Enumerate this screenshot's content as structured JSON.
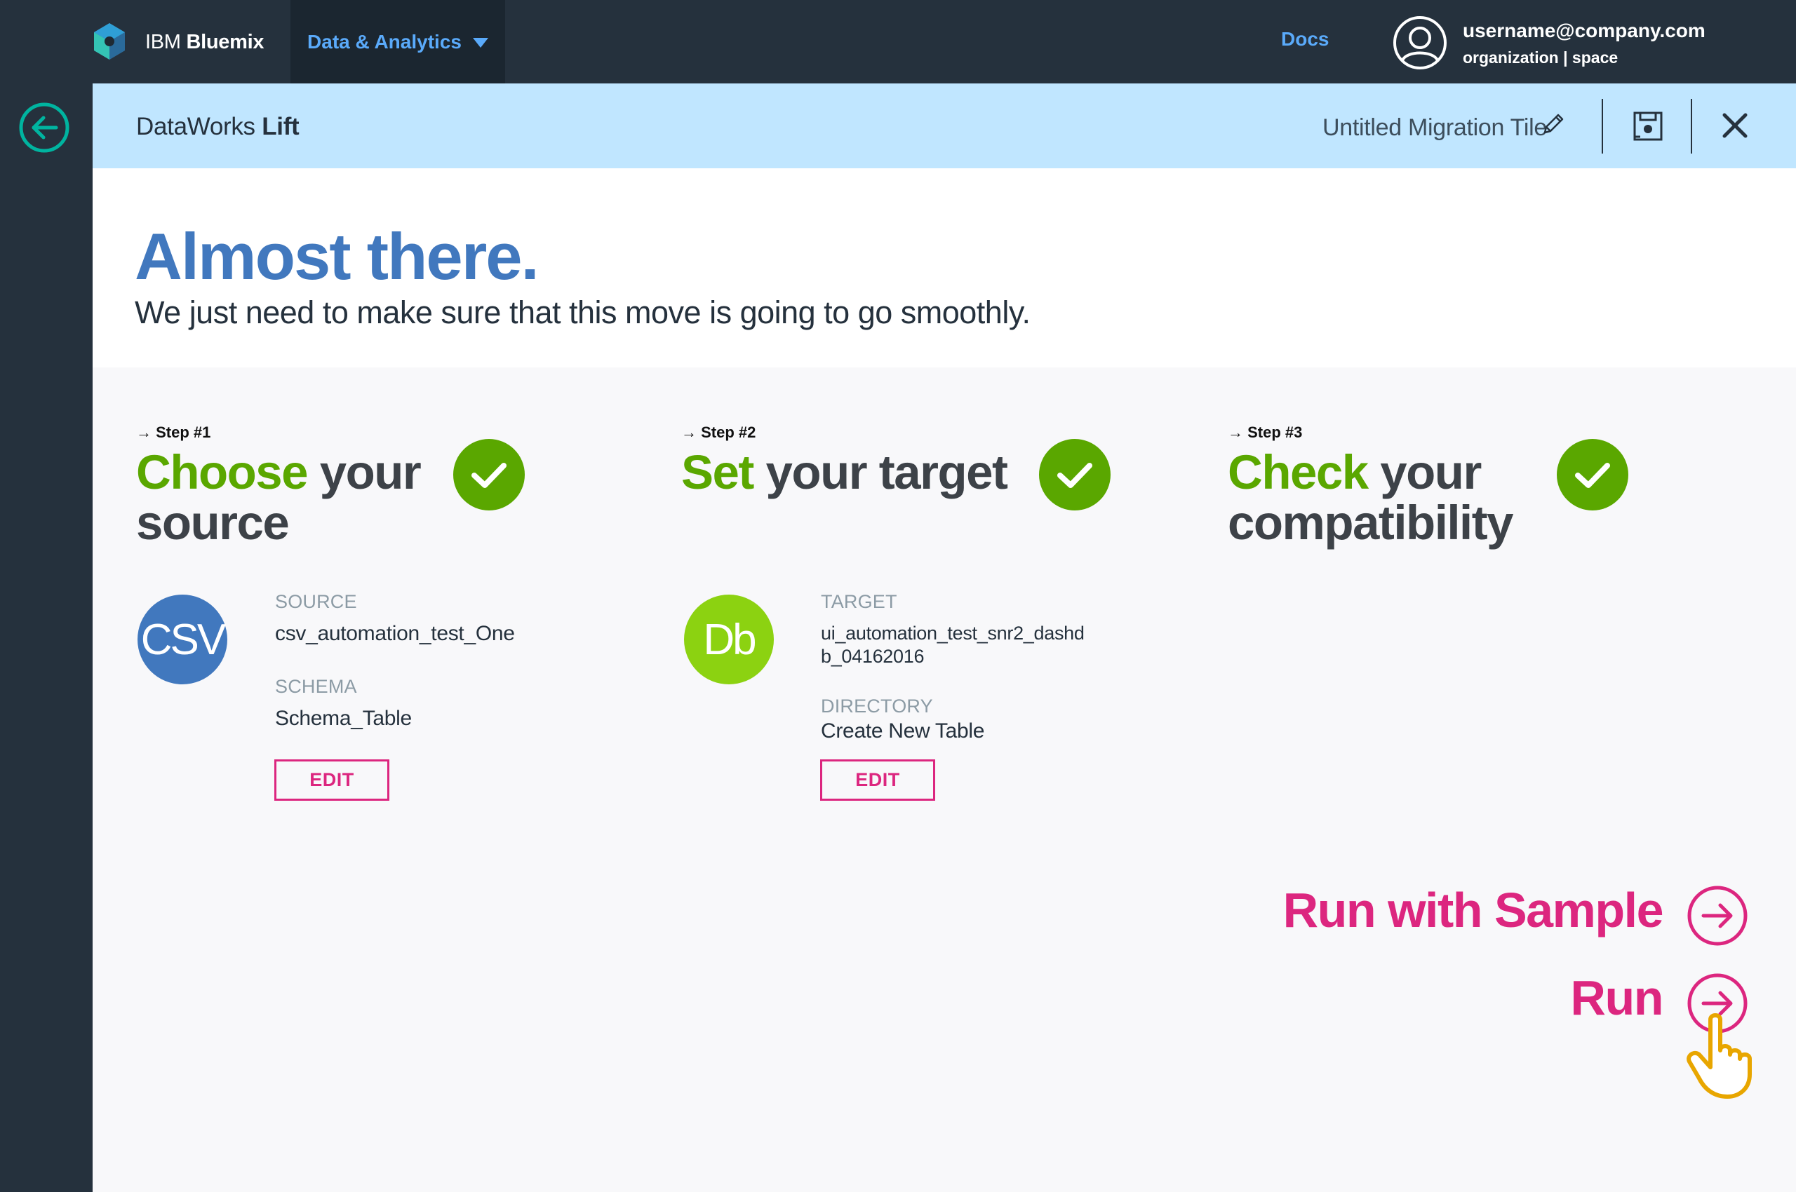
{
  "topbar": {
    "brand_prefix": "IBM",
    "brand_name": "Bluemix",
    "nav_section": "Data & Analytics",
    "docs_label": "Docs",
    "user_email": "username@company.com",
    "user_org": "organization | space"
  },
  "header": {
    "product_prefix": "DataWorks",
    "product_name": "Lift",
    "tile_name": "Untitled Migration Tile"
  },
  "hero": {
    "title": "Almost there.",
    "subtitle": "We just need to make sure that this move is going to go smoothly."
  },
  "steps": [
    {
      "kicker": "→ Step #1",
      "title_accent": "Choose",
      "title_line1_rest": " your",
      "title_line2": "source",
      "status": "complete"
    },
    {
      "kicker": "→ Step #2",
      "title_accent": "Set",
      "title_line1_rest": " your target",
      "title_line2": "",
      "status": "complete"
    },
    {
      "kicker": "→ Step #3",
      "title_accent": "Check",
      "title_line1_rest": " your",
      "title_line2": "compatibility",
      "status": "complete"
    }
  ],
  "source": {
    "badge": "CSV",
    "source_label": "SOURCE",
    "source_value": "csv_automation_test_One",
    "schema_label": "SCHEMA",
    "schema_value": "Schema_Table",
    "edit_label": "EDIT"
  },
  "target": {
    "badge": "Db",
    "target_label": "TARGET",
    "target_value_line1": "ui_automation_test_snr2_dashd",
    "target_value_line2": "b_04162016",
    "directory_label": "DIRECTORY",
    "directory_value": "Create New Table",
    "edit_label": "EDIT"
  },
  "actions": {
    "run_sample_label": "Run with Sample",
    "run_label": "Run"
  },
  "colors": {
    "nav_dark": "#25313d",
    "accent_blue": "#5aaafa",
    "header_blue": "#c0e6ff",
    "title_blue": "#4178be",
    "success_green": "#5aa700",
    "db_green": "#8cd211",
    "action_pink": "#dc267f",
    "teal": "#00b4a0",
    "cursor_gold": "#e8a600"
  },
  "icons": {
    "back": "arrow-left-circle-icon",
    "edit_tile": "pencil-icon",
    "save": "save-icon",
    "close": "close-icon",
    "step_status": "checkmark-circle-icon",
    "run": "arrow-right-circle-icon",
    "cursor": "pointer-hand-icon"
  }
}
